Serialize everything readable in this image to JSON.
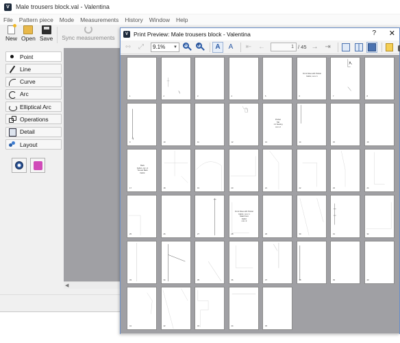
{
  "main_window": {
    "title": "Male trousers block.val - Valentina",
    "menu": [
      "File",
      "Pattern piece",
      "Mode",
      "Measurements",
      "History",
      "Window",
      "Help"
    ],
    "toolbar": [
      {
        "label": "New",
        "icon": "new-file-icon",
        "enabled": true
      },
      {
        "label": "Open",
        "icon": "open-folder-icon",
        "enabled": true
      },
      {
        "label": "Save",
        "icon": "save-disk-icon",
        "enabled": true
      },
      {
        "label": "Sync measurements",
        "icon": "sync-icon",
        "enabled": false
      }
    ],
    "tools": [
      {
        "label": "Point",
        "icon": "point-icon",
        "active": true
      },
      {
        "label": "Line",
        "icon": "line-icon"
      },
      {
        "label": "Curve",
        "icon": "curve-icon"
      },
      {
        "label": "Arc",
        "icon": "arc-icon"
      },
      {
        "label": "Elliptical Arc",
        "icon": "elliptical-arc-icon"
      },
      {
        "label": "Operations",
        "icon": "operations-icon"
      },
      {
        "label": "Detail",
        "icon": "detail-icon"
      },
      {
        "label": "Layout",
        "icon": "layout-icon"
      }
    ],
    "layout_tool_icons": [
      "layout-settings-icon",
      "export-layout-icon"
    ]
  },
  "dialog": {
    "title": "Print Preview: Male trousers block - Valentina",
    "help_label": "?",
    "close_label": "✕",
    "zoom": "9.1%",
    "current_page": "1",
    "page_total": "/ 45",
    "toolbar_icons": [
      "fit-width-icon",
      "fit-page-icon",
      "zoom-out-icon",
      "zoom-in-icon",
      "portrait-icon",
      "landscape-icon",
      "first-page-icon",
      "previous-page-icon",
      "next-page-icon",
      "last-page-icon",
      "single-page-view-icon",
      "facing-pages-view-icon",
      "overview-all-pages-icon",
      "page-setup-icon",
      "print-icon"
    ],
    "accent": "#4a72b0",
    "page_count": 45,
    "pages_per_row": 8,
    "page_text": {
      "p6": [
        "Front Dose with Pocket",
        "Fabric, cut x 1"
      ],
      "p13": [
        "Pocket",
        "Tab",
        "1:1 Sewing",
        "cut x 2"
      ],
      "p17": [
        "Back",
        "Fabric, cut x 2",
        "Trouser Back",
        "Fabric"
      ],
      "p28": [
        "Front Dose with Pocket",
        "Fabric, cut x 1",
        "Male Front",
        "Fabric",
        "cut x 2"
      ]
    }
  }
}
